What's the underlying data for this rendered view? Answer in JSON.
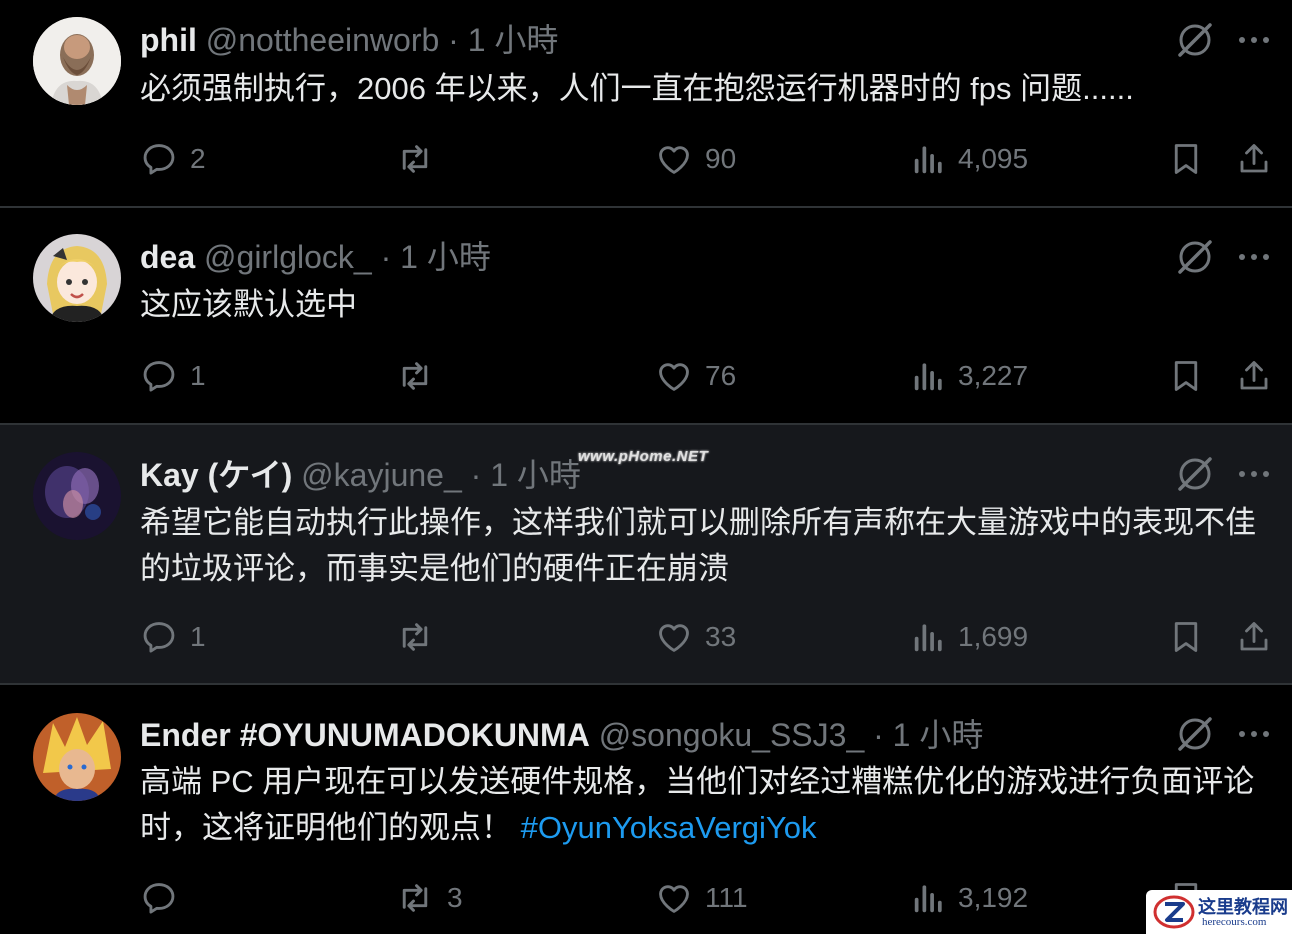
{
  "posts": [
    {
      "name": "phil",
      "handle": "@nottheeinworb",
      "dot": "·",
      "time": "1 小時",
      "text": "必须强制执行，2006 年以来，人们一直在抱怨运行机器时的 fps 问题......",
      "hashtag": "",
      "replies": "2",
      "reposts": "",
      "likes": "90",
      "views": "4,095"
    },
    {
      "name": "dea",
      "handle": "@girlglock_",
      "dot": "·",
      "time": "1 小時",
      "text": "这应该默认选中",
      "hashtag": "",
      "replies": "1",
      "reposts": "",
      "likes": "76",
      "views": "3,227"
    },
    {
      "name": "Kay (ケイ)",
      "handle": "@kayjune_",
      "dot": "·",
      "time": "1 小時",
      "text": "希望它能自动执行此操作，这样我们就可以删除所有声称在大量游戏中的表现不佳的垃圾评论，而事实是他们的硬件正在崩溃",
      "hashtag": "",
      "replies": "1",
      "reposts": "",
      "likes": "33",
      "views": "1,699"
    },
    {
      "name": "Ender #OYUNUMADOKUNMA",
      "handle": "@songoku_SSJ3_",
      "dot": "·",
      "time": "1 小時",
      "text": "高端 PC 用户现在可以发送硬件规格，当他们对经过糟糕优化的游戏进行负面评论时，这将证明他们的观点！",
      "hashtag": "#OyunYoksaVergiYok",
      "replies": "",
      "reposts": "3",
      "likes": "111",
      "views": "3,192"
    }
  ],
  "watermarks": {
    "center": "www.pHome.NET",
    "badge_title": "这里教程网",
    "badge_url": "herecours.com"
  },
  "colors": {
    "background": "#000000",
    "highlight_row": "#16181c",
    "divider": "#2f3336",
    "text": "#e7e9ea",
    "muted": "#71767b",
    "link": "#1d9bf0"
  },
  "icons": [
    "grok-icon",
    "more-icon",
    "reply-icon",
    "repost-icon",
    "like-icon",
    "views-icon",
    "bookmark-icon",
    "share-icon"
  ]
}
